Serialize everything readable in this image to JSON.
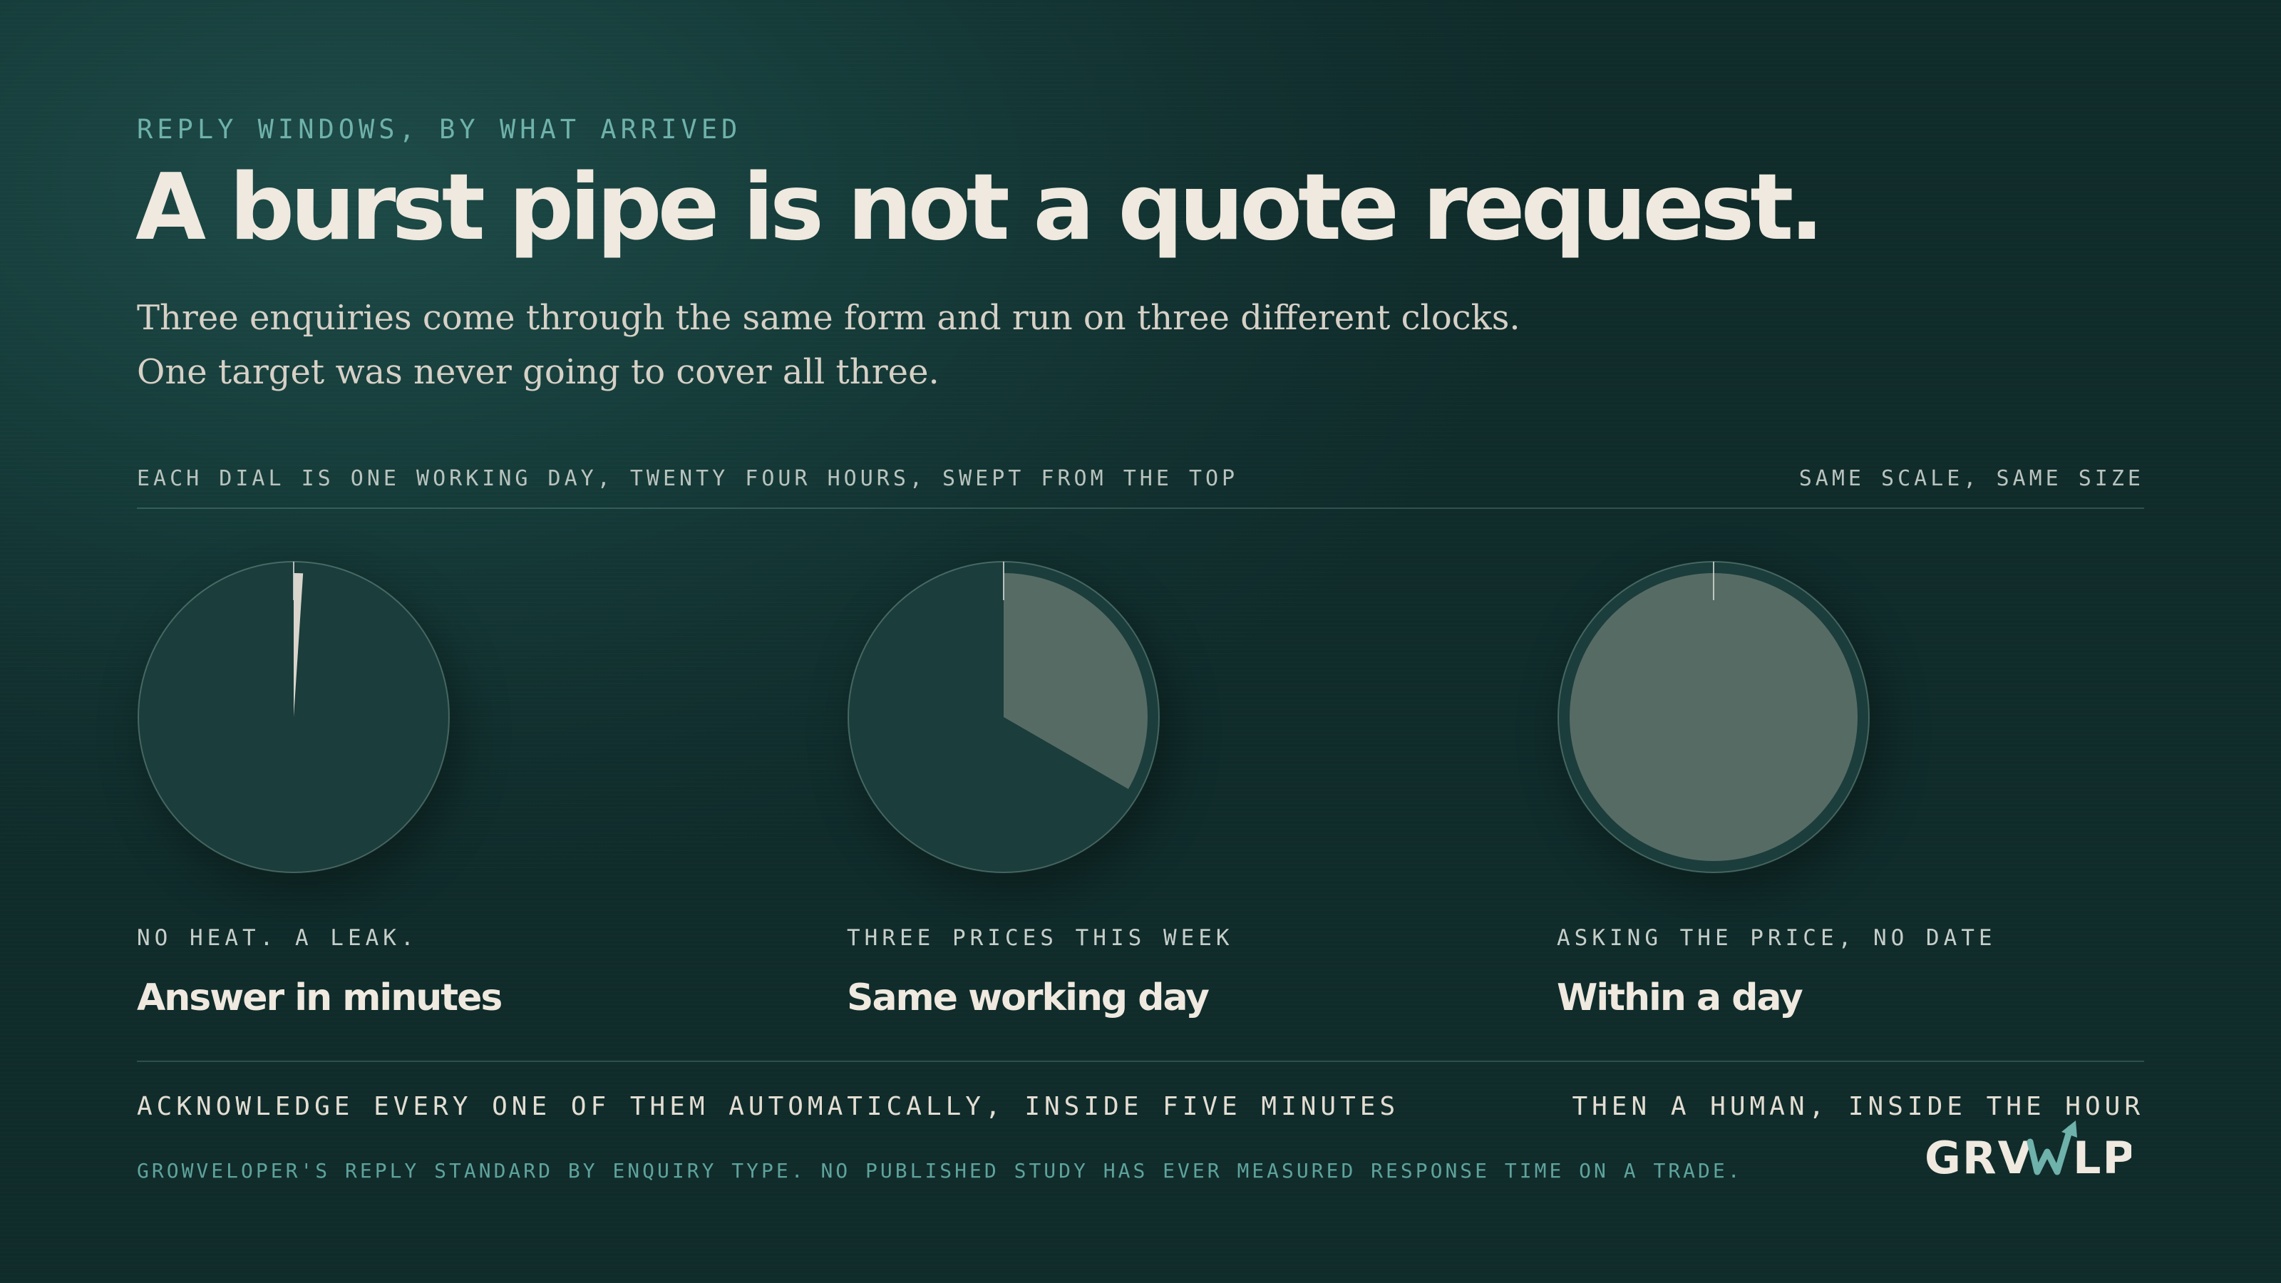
{
  "header": {
    "eyebrow": "REPLY WINDOWS, BY WHAT ARRIVED",
    "title": "A burst pipe is not a quote request.",
    "subtitle": "Three enquiries come through the same form and run on three different clocks. One target was never going to cover all three."
  },
  "notes": {
    "left": "EACH DIAL IS ONE WORKING DAY, TWENTY FOUR HOURS, SWEPT FROM THE TOP",
    "right": "SAME SCALE, SAME SIZE"
  },
  "chart_data": {
    "type": "pie",
    "scale_hours": 24,
    "sweep_start": "top",
    "dials": [
      {
        "tag": "NO HEAT. A LEAK.",
        "label": "Answer in minutes",
        "value_hours": 0.25
      },
      {
        "tag": "THREE PRICES THIS WEEK",
        "label": "Same working day",
        "value_hours": 8
      },
      {
        "tag": "ASKING THE PRICE, NO DATE",
        "label": "Within a day",
        "value_hours": 24
      }
    ]
  },
  "footer": {
    "left": "ACKNOWLEDGE EVERY ONE OF THEM AUTOMATICALLY, INSIDE FIVE MINUTES",
    "right": "THEN A HUMAN, INSIDE THE HOUR",
    "source": "GROWVELOPER'S REPLY STANDARD BY ENQUIRY TYPE. NO PUBLISHED STUDY HAS EVER MEASURED RESPONSE TIME ON A TRADE.",
    "logo_text": "GRWLP"
  },
  "colors": {
    "background": "#133634",
    "dial_face": "#1b3d3b",
    "dial_fill": "#576b65",
    "first_fill": "#d9d4cc",
    "accent": "#6fb1ab",
    "text": "#efe9df"
  }
}
